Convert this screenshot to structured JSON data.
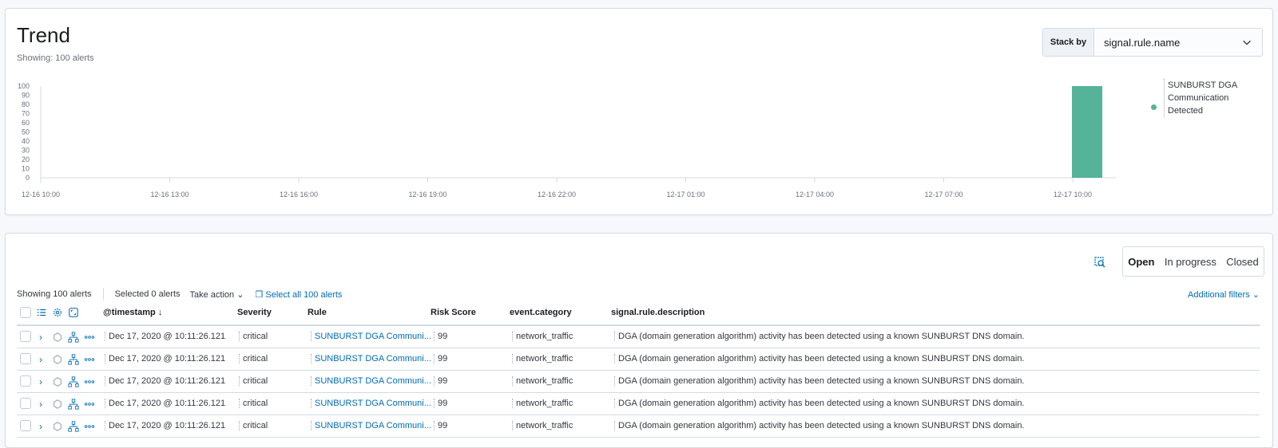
{
  "trend": {
    "title": "Trend",
    "subtitle": "Showing: 100 alerts",
    "stack_by_label": "Stack by",
    "stack_by_value": "signal.rule.name",
    "legend": "SUNBURST DGA Communication Detected",
    "legend_color": "#54b399"
  },
  "chart_data": {
    "type": "bar",
    "y_ticks": [
      "100",
      "90",
      "80",
      "70",
      "60",
      "50",
      "40",
      "30",
      "20",
      "10",
      "0"
    ],
    "x_ticks": [
      "12-16 10:00",
      "12-16 13:00",
      "12-16 16:00",
      "12-16 19:00",
      "12-16 22:00",
      "12-17 01:00",
      "12-17 04:00",
      "12-17 07:00",
      "12-17 10:00"
    ],
    "ylim": [
      0,
      100
    ],
    "series": [
      {
        "name": "SUNBURST DGA Communication Detected",
        "color": "#54b399",
        "points": [
          {
            "x": "12-17 10:00",
            "y": 100
          }
        ]
      }
    ]
  },
  "alerts": {
    "status_tabs": [
      "Open",
      "In progress",
      "Closed"
    ],
    "showing": "Showing 100 alerts",
    "selected": "Selected 0 alerts",
    "take_action": "Take action",
    "select_all": "Select all 100 alerts",
    "additional_filters": "Additional filters",
    "columns": [
      "@timestamp",
      "Severity",
      "Rule",
      "Risk Score",
      "event.category",
      "signal.rule.description"
    ],
    "rows": [
      {
        "timestamp": "Dec 17, 2020 @ 10:11:26.121",
        "severity": "critical",
        "rule": "SUNBURST DGA Communi...",
        "risk": "99",
        "category": "network_traffic",
        "description": "DGA (domain generation algorithm) activity has been detected using a known SUNBURST DNS domain."
      },
      {
        "timestamp": "Dec 17, 2020 @ 10:11:26.121",
        "severity": "critical",
        "rule": "SUNBURST DGA Communi...",
        "risk": "99",
        "category": "network_traffic",
        "description": "DGA (domain generation algorithm) activity has been detected using a known SUNBURST DNS domain."
      },
      {
        "timestamp": "Dec 17, 2020 @ 10:11:26.121",
        "severity": "critical",
        "rule": "SUNBURST DGA Communi...",
        "risk": "99",
        "category": "network_traffic",
        "description": "DGA (domain generation algorithm) activity has been detected using a known SUNBURST DNS domain."
      },
      {
        "timestamp": "Dec 17, 2020 @ 10:11:26.121",
        "severity": "critical",
        "rule": "SUNBURST DGA Communi...",
        "risk": "99",
        "category": "network_traffic",
        "description": "DGA (domain generation algorithm) activity has been detected using a known SUNBURST DNS domain."
      },
      {
        "timestamp": "Dec 17, 2020 @ 10:11:26.121",
        "severity": "critical",
        "rule": "SUNBURST DGA Communi...",
        "risk": "99",
        "category": "network_traffic",
        "description": "DGA (domain generation algorithm) activity has been detected using a known SUNBURST DNS domain."
      }
    ]
  }
}
